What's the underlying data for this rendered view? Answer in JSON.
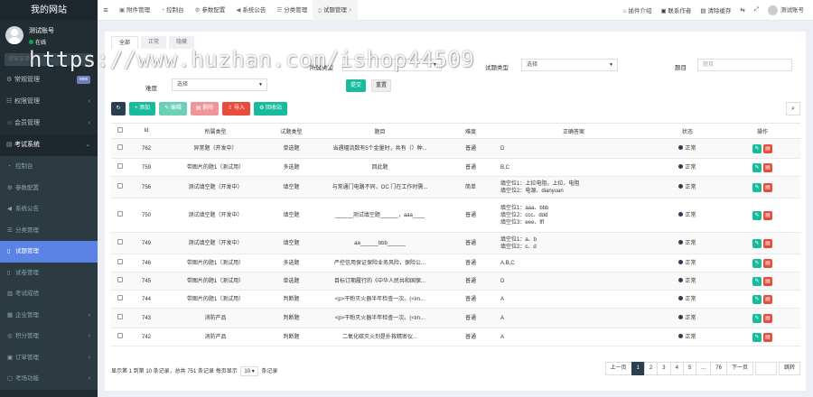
{
  "sidebar": {
    "logo": "我的网站",
    "user_name": "测试账号",
    "user_status": "在线",
    "search_placeholder": "搜索菜单",
    "top_items": [
      {
        "label": "常规管理",
        "icon": "gear-icon",
        "badge": "new"
      },
      {
        "label": "权限管理",
        "icon": "group-icon"
      },
      {
        "label": "会员管理",
        "icon": "user-icon"
      },
      {
        "label": "考试系统",
        "icon": "book-icon"
      }
    ],
    "sub_items": [
      {
        "label": "控制台",
        "icon": "dashboard-icon"
      },
      {
        "label": "参数配置",
        "icon": "cogs-icon"
      },
      {
        "label": "系统公告",
        "icon": "bullhorn-icon"
      },
      {
        "label": "分类管理",
        "icon": "list-icon"
      },
      {
        "label": "试题管理",
        "icon": "file-icon"
      },
      {
        "label": "试卷管理",
        "icon": "paper-icon"
      },
      {
        "label": "考试成绩",
        "icon": "chart-icon"
      },
      {
        "label": "企业管理",
        "icon": "building-icon"
      },
      {
        "label": "积分管理",
        "icon": "coins-icon"
      },
      {
        "label": "订单管理",
        "icon": "cart-icon"
      },
      {
        "label": "考场功能",
        "icon": "room-icon"
      }
    ]
  },
  "topbar": {
    "tabs": [
      "附件管理",
      "控制台",
      "参数配置",
      "系统公告",
      "分类管理",
      "试题管理"
    ],
    "right": [
      "插件介绍",
      "联系作者",
      "清除缓存"
    ],
    "user": "测试账号"
  },
  "panel": {
    "tabs": [
      "全部",
      "正常",
      "隐藏"
    ],
    "filter": {
      "type_label": "所属类型",
      "qtype_label": "试题类型",
      "qtype_value": "选择",
      "title_label": "题目",
      "title_placeholder": "题目",
      "difficulty_label": "难度",
      "difficulty_value": "选择",
      "submit": "提交",
      "reset": "重置"
    },
    "toolbar": {
      "add": "添加",
      "edit": "编辑",
      "delete": "删除",
      "import": "导入",
      "recycle": "回收站"
    },
    "columns": [
      "Id",
      "所属类型",
      "试题类型",
      "题目",
      "难度",
      "正确答案",
      "状态",
      "操作"
    ],
    "rows": [
      {
        "id": "762",
        "cat": "异常题（开发中）",
        "qtype": "单选题",
        "qcls": "t-green",
        "title": "当遇辐流数有5个金量时，共有（）种...",
        "diff": "普通",
        "dcls": "t-green",
        "answer": [
          "D"
        ],
        "status": "正常"
      },
      {
        "id": "759",
        "cat": "带图片的题1（测试用）",
        "qtype": "多选题",
        "qcls": "t-red",
        "title": "回此题",
        "diff": "普通",
        "dcls": "t-green",
        "answer": [
          "B,C"
        ],
        "status": "正常"
      },
      {
        "id": "756",
        "cat": "测试填空题（开发中）",
        "qtype": "填空题",
        "qcls": "t-orange",
        "title": "与常通门电路不同，OC 门在工作时需...",
        "diff": "简单",
        "dcls": "t-gray",
        "answer": [
          "填空位1：上拉电阻，上拉、电阻",
          "填空位2：电源、dianyuan"
        ],
        "status": "正常"
      },
      {
        "id": "750",
        "cat": "测试填空题（开发中）",
        "qtype": "填空题",
        "qcls": "t-orange",
        "title": "______测试填空题______，aaa____",
        "diff": "普通",
        "dcls": "t-green",
        "answer": [
          "填空位1：aaa、bbb",
          "填空位2：ccc、ddd",
          "填空位3：eee、fff"
        ],
        "status": "正常"
      },
      {
        "id": "749",
        "cat": "测试填空题（开发中）",
        "qtype": "填空题",
        "qcls": "t-orange",
        "title": "aa______bbb______",
        "diff": "普通",
        "dcls": "t-green",
        "answer": [
          "填空位1：a、b",
          "填空位2：c、d"
        ],
        "status": "正常"
      },
      {
        "id": "746",
        "cat": "带图片的题1（测试用）",
        "qtype": "多选题",
        "qcls": "t-red",
        "title": "严控信用保证保险业务风险，保险公...",
        "diff": "普通",
        "dcls": "t-green",
        "answer": [
          "A,B,C"
        ],
        "status": "正常"
      },
      {
        "id": "745",
        "cat": "带图片的题1（测试用）",
        "qtype": "单选题",
        "qcls": "t-green",
        "title": "目标订期履行的《中华人民共和国保...",
        "diff": "普通",
        "dcls": "t-green",
        "answer": [
          "D"
        ],
        "status": "正常"
      },
      {
        "id": "744",
        "cat": "带图片的题1（测试用）",
        "qtype": "判断题",
        "qcls": "t-gray",
        "title": "<p>干粉灭火器半年检查一次。(<im...",
        "diff": "普通",
        "dcls": "t-green",
        "answer": [
          "A"
        ],
        "status": "正常"
      },
      {
        "id": "743",
        "cat": "消防产品",
        "qtype": "判断题",
        "qcls": "t-gray",
        "title": "<p>干粉灭火器半年检查一次。(<im...",
        "diff": "普通",
        "dcls": "t-green",
        "answer": [
          "A"
        ],
        "status": "正常"
      },
      {
        "id": "742",
        "cat": "消防产品",
        "qtype": "判断题",
        "qcls": "t-gray",
        "title": "二氧化碳灭火剂是扑救精密仪...",
        "diff": "普通",
        "dcls": "t-green",
        "answer": [
          "A"
        ],
        "status": "正常"
      }
    ],
    "footer": {
      "before": "显示第 1 到第 10 条记录，总共 751 条记录 每页显示",
      "page_size": "10",
      "after": "条记录"
    },
    "pager": [
      "上一页",
      "1",
      "2",
      "3",
      "4",
      "5",
      "...",
      "76",
      "下一页"
    ],
    "jump": "跳转"
  },
  "watermark": "https://www.huzhan.com/ishop44509"
}
